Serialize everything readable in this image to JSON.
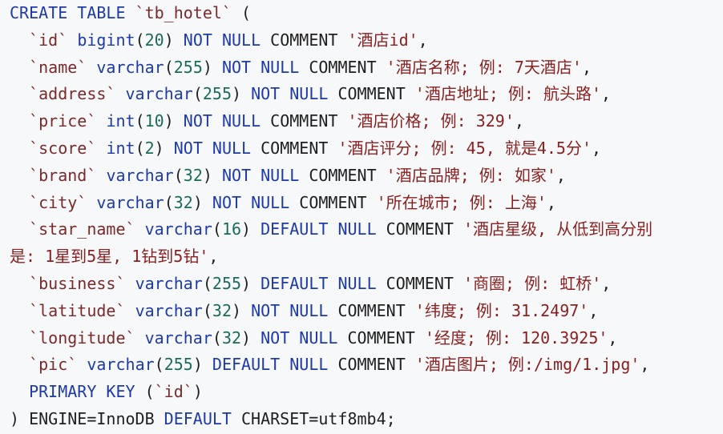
{
  "lines": [
    [
      {
        "t": "kw",
        "v": "CREATE TABLE "
      },
      {
        "t": "id",
        "v": "`tb_hotel`"
      },
      {
        "t": "pn",
        "v": " ("
      }
    ],
    [
      {
        "t": "pn",
        "v": "  "
      },
      {
        "t": "id",
        "v": "`id`"
      },
      {
        "t": "pn",
        "v": " "
      },
      {
        "t": "ty",
        "v": "bigint"
      },
      {
        "t": "pn",
        "v": "("
      },
      {
        "t": "num",
        "v": "20"
      },
      {
        "t": "pn",
        "v": ") "
      },
      {
        "t": "kw",
        "v": "NOT NULL "
      },
      {
        "t": "cm",
        "v": "COMMENT "
      },
      {
        "t": "str",
        "v": "'酒店id'"
      },
      {
        "t": "pn",
        "v": ","
      }
    ],
    [
      {
        "t": "pn",
        "v": "  "
      },
      {
        "t": "id",
        "v": "`name`"
      },
      {
        "t": "pn",
        "v": " "
      },
      {
        "t": "ty",
        "v": "varchar"
      },
      {
        "t": "pn",
        "v": "("
      },
      {
        "t": "num",
        "v": "255"
      },
      {
        "t": "pn",
        "v": ") "
      },
      {
        "t": "kw",
        "v": "NOT NULL "
      },
      {
        "t": "cm",
        "v": "COMMENT "
      },
      {
        "t": "str",
        "v": "'酒店名称; 例: 7天酒店'"
      },
      {
        "t": "pn",
        "v": ","
      }
    ],
    [
      {
        "t": "pn",
        "v": "  "
      },
      {
        "t": "id",
        "v": "`address`"
      },
      {
        "t": "pn",
        "v": " "
      },
      {
        "t": "ty",
        "v": "varchar"
      },
      {
        "t": "pn",
        "v": "("
      },
      {
        "t": "num",
        "v": "255"
      },
      {
        "t": "pn",
        "v": ") "
      },
      {
        "t": "kw",
        "v": "NOT NULL "
      },
      {
        "t": "cm",
        "v": "COMMENT "
      },
      {
        "t": "str",
        "v": "'酒店地址; 例: 航头路'"
      },
      {
        "t": "pn",
        "v": ","
      }
    ],
    [
      {
        "t": "pn",
        "v": "  "
      },
      {
        "t": "id",
        "v": "`price`"
      },
      {
        "t": "pn",
        "v": " "
      },
      {
        "t": "ty",
        "v": "int"
      },
      {
        "t": "pn",
        "v": "("
      },
      {
        "t": "num",
        "v": "10"
      },
      {
        "t": "pn",
        "v": ") "
      },
      {
        "t": "kw",
        "v": "NOT NULL "
      },
      {
        "t": "cm",
        "v": "COMMENT "
      },
      {
        "t": "str",
        "v": "'酒店价格; 例: 329'"
      },
      {
        "t": "pn",
        "v": ","
      }
    ],
    [
      {
        "t": "pn",
        "v": "  "
      },
      {
        "t": "id",
        "v": "`score`"
      },
      {
        "t": "pn",
        "v": " "
      },
      {
        "t": "ty",
        "v": "int"
      },
      {
        "t": "pn",
        "v": "("
      },
      {
        "t": "num",
        "v": "2"
      },
      {
        "t": "pn",
        "v": ") "
      },
      {
        "t": "kw",
        "v": "NOT NULL "
      },
      {
        "t": "cm",
        "v": "COMMENT "
      },
      {
        "t": "str",
        "v": "'酒店评分; 例: 45, 就是4.5分'"
      },
      {
        "t": "pn",
        "v": ","
      }
    ],
    [
      {
        "t": "pn",
        "v": "  "
      },
      {
        "t": "id",
        "v": "`brand`"
      },
      {
        "t": "pn",
        "v": " "
      },
      {
        "t": "ty",
        "v": "varchar"
      },
      {
        "t": "pn",
        "v": "("
      },
      {
        "t": "num",
        "v": "32"
      },
      {
        "t": "pn",
        "v": ") "
      },
      {
        "t": "kw",
        "v": "NOT NULL "
      },
      {
        "t": "cm",
        "v": "COMMENT "
      },
      {
        "t": "str",
        "v": "'酒店品牌; 例: 如家'"
      },
      {
        "t": "pn",
        "v": ","
      }
    ],
    [
      {
        "t": "pn",
        "v": "  "
      },
      {
        "t": "id",
        "v": "`city`"
      },
      {
        "t": "pn",
        "v": " "
      },
      {
        "t": "ty",
        "v": "varchar"
      },
      {
        "t": "pn",
        "v": "("
      },
      {
        "t": "num",
        "v": "32"
      },
      {
        "t": "pn",
        "v": ") "
      },
      {
        "t": "kw",
        "v": "NOT NULL "
      },
      {
        "t": "cm",
        "v": "COMMENT "
      },
      {
        "t": "str",
        "v": "'所在城市; 例: 上海'"
      },
      {
        "t": "pn",
        "v": ","
      }
    ],
    [
      {
        "t": "pn",
        "v": "  "
      },
      {
        "t": "id",
        "v": "`star_name`"
      },
      {
        "t": "pn",
        "v": " "
      },
      {
        "t": "ty",
        "v": "varchar"
      },
      {
        "t": "pn",
        "v": "("
      },
      {
        "t": "num",
        "v": "16"
      },
      {
        "t": "pn",
        "v": ") "
      },
      {
        "t": "kw",
        "v": "DEFAULT NULL "
      },
      {
        "t": "cm",
        "v": "COMMENT "
      },
      {
        "t": "str",
        "v": "'酒店星级, 从低到高分别"
      }
    ],
    [
      {
        "t": "str",
        "v": "是: 1星到5星, 1钻到5钻'"
      },
      {
        "t": "pn",
        "v": ","
      }
    ],
    [
      {
        "t": "pn",
        "v": "  "
      },
      {
        "t": "id",
        "v": "`business`"
      },
      {
        "t": "pn",
        "v": " "
      },
      {
        "t": "ty",
        "v": "varchar"
      },
      {
        "t": "pn",
        "v": "("
      },
      {
        "t": "num",
        "v": "255"
      },
      {
        "t": "pn",
        "v": ") "
      },
      {
        "t": "kw",
        "v": "DEFAULT NULL "
      },
      {
        "t": "cm",
        "v": "COMMENT "
      },
      {
        "t": "str",
        "v": "'商圈; 例: 虹桥'"
      },
      {
        "t": "pn",
        "v": ","
      }
    ],
    [
      {
        "t": "pn",
        "v": "  "
      },
      {
        "t": "id",
        "v": "`latitude`"
      },
      {
        "t": "pn",
        "v": " "
      },
      {
        "t": "ty",
        "v": "varchar"
      },
      {
        "t": "pn",
        "v": "("
      },
      {
        "t": "num",
        "v": "32"
      },
      {
        "t": "pn",
        "v": ") "
      },
      {
        "t": "kw",
        "v": "NOT NULL "
      },
      {
        "t": "cm",
        "v": "COMMENT "
      },
      {
        "t": "str",
        "v": "'纬度; 例: 31.2497'"
      },
      {
        "t": "pn",
        "v": ","
      }
    ],
    [
      {
        "t": "pn",
        "v": "  "
      },
      {
        "t": "id",
        "v": "`longitude`"
      },
      {
        "t": "pn",
        "v": " "
      },
      {
        "t": "ty",
        "v": "varchar"
      },
      {
        "t": "pn",
        "v": "("
      },
      {
        "t": "num",
        "v": "32"
      },
      {
        "t": "pn",
        "v": ") "
      },
      {
        "t": "kw",
        "v": "NOT NULL "
      },
      {
        "t": "cm",
        "v": "COMMENT "
      },
      {
        "t": "str",
        "v": "'经度; 例: 120.3925'"
      },
      {
        "t": "pn",
        "v": ","
      }
    ],
    [
      {
        "t": "pn",
        "v": "  "
      },
      {
        "t": "id",
        "v": "`pic`"
      },
      {
        "t": "pn",
        "v": " "
      },
      {
        "t": "ty",
        "v": "varchar"
      },
      {
        "t": "pn",
        "v": "("
      },
      {
        "t": "num",
        "v": "255"
      },
      {
        "t": "pn",
        "v": ") "
      },
      {
        "t": "kw",
        "v": "DEFAULT NULL "
      },
      {
        "t": "cm",
        "v": "COMMENT "
      },
      {
        "t": "str",
        "v": "'酒店图片; 例:/img/1.jpg'"
      },
      {
        "t": "pn",
        "v": ","
      }
    ],
    [
      {
        "t": "pn",
        "v": "  "
      },
      {
        "t": "kw",
        "v": "PRIMARY KEY "
      },
      {
        "t": "pn",
        "v": "("
      },
      {
        "t": "id",
        "v": "`id`"
      },
      {
        "t": "pn",
        "v": ")"
      }
    ],
    [
      {
        "t": "pn",
        "v": ") "
      },
      {
        "t": "cm",
        "v": "ENGINE=InnoDB "
      },
      {
        "t": "kw",
        "v": "DEFAULT "
      },
      {
        "t": "cm",
        "v": "CHARSET=utf8mb4;"
      }
    ]
  ]
}
